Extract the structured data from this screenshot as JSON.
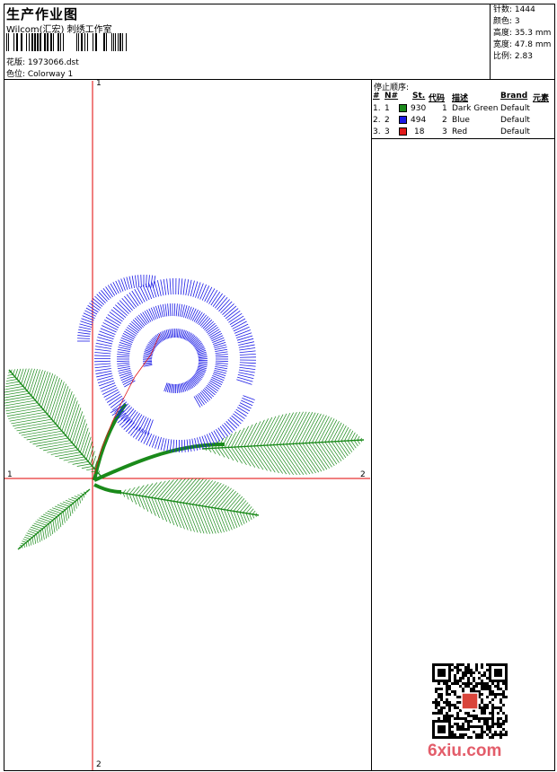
{
  "header": {
    "title": "生产作业图",
    "subtitle": "Wilcom(汇宏) 刺绣工作室",
    "design_label": "花版: 1973066.dst",
    "colorway_label": "色位: Colorway 1"
  },
  "stats": [
    {
      "label": "针数:",
      "value": "1444"
    },
    {
      "label": "颜色:",
      "value": "3"
    },
    {
      "label": "高度:",
      "value": "35.3 mm"
    },
    {
      "label": "宽度:",
      "value": "47.8 mm"
    },
    {
      "label": "比例:",
      "value": "2.83"
    }
  ],
  "stop_sequence": {
    "title": "停止顺序:",
    "headers": {
      "num": "#",
      "n": "N#",
      "st": "St.",
      "code": "代码",
      "desc": "描述",
      "brand": "Brand",
      "element": "元素"
    },
    "rows": [
      {
        "num": "1.",
        "n": "1",
        "color": "#1a8a1a",
        "st": "930",
        "code": "1",
        "desc": "Dark Green",
        "brand": "Default"
      },
      {
        "num": "2.",
        "n": "2",
        "color": "#1a1ae6",
        "st": "494",
        "code": "2",
        "desc": "Blue",
        "brand": "Default"
      },
      {
        "num": "3.",
        "n": "3",
        "color": "#e01a1a",
        "st": "18",
        "code": "3",
        "desc": "Red",
        "brand": "Default"
      }
    ]
  },
  "axes": {
    "v_top": "1",
    "v_bottom": "2",
    "h_left": "1",
    "h_right": "2",
    "axis_color": "#e00000"
  },
  "watermark": "6xiu.com",
  "qr_stamp": "shop"
}
